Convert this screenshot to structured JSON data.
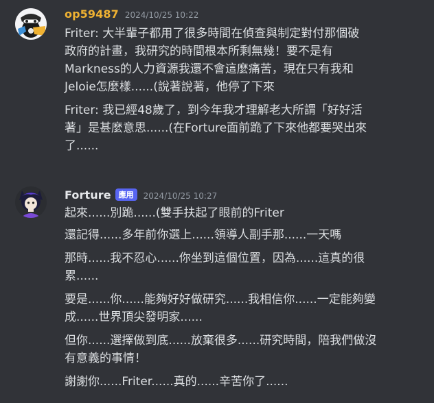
{
  "messages": [
    {
      "author": "op59487",
      "author_color": "#f0b232",
      "timestamp": "2024/10/25 10:22",
      "avatar": "avatar-image",
      "paragraphs": [
        [
          "Friter: 大半輩子都用了很多時間在偵查與制定對付那個破",
          "政府的計畫，我研究的時間根本所剩無幾！要不是有",
          "Markness的人力資源我還不會這麼痛苦，現在只有我和",
          "Jeloie怎麼樣......(說著說著，他停了下來"
        ],
        [
          "Friter: 我已經48歲了，到今年我才理解老大所謂「好好活",
          "著」是甚麼意思......(在Forture面前跪了下來他都要哭出來",
          "了......"
        ]
      ]
    },
    {
      "author": "Forture",
      "author_color": "#e6e8eb",
      "badge": "應用",
      "timestamp": "2024/10/25 10:27",
      "avatar": "avatar-image",
      "paragraphs": [
        [
          "起來......別跪......(雙手扶起了眼前的Friter"
        ],
        [
          "還記得......多年前你選上......領導人副手那......一天嗎"
        ],
        [
          "那時......我不忍心......你坐到這個位置，因為......這真的很",
          "累......"
        ],
        [
          "要是......你......能夠好好做研究......我相信你......一定能夠變",
          "成......世界頂尖發明家......"
        ],
        [
          "但你......選擇做到底......放棄很多......研究時間，陪我們做沒",
          "有意義的事情！"
        ],
        [
          "謝謝你......Friter......真的......辛苦你了......"
        ]
      ]
    }
  ]
}
